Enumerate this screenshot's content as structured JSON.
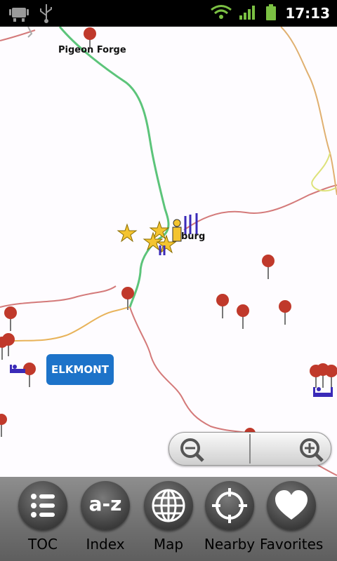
{
  "status_bar": {
    "time": "17:13",
    "icons": [
      "android-debug-icon",
      "usb-icon",
      "wifi-icon",
      "signal-icon",
      "battery-icon"
    ]
  },
  "map": {
    "places": {
      "pigeon_forge": "Pigeon Forge",
      "gatlinburg_partial": "burg"
    },
    "elkmont_button": "ELKMONT",
    "colors": {
      "road_green": "#5cc47a",
      "road_red": "#d06a6a",
      "road_orange": "#e8b35a",
      "road_yellow": "#dde27a",
      "pin": "#c0392b",
      "star": "#f4c430",
      "poi_blue": "#2a2ab0"
    }
  },
  "zoom": {
    "zoom_out_icon": "zoom-out-icon",
    "zoom_in_icon": "zoom-in-icon"
  },
  "toolbar": {
    "items": [
      {
        "label": "TOC",
        "icon": "list-icon"
      },
      {
        "label": "Index",
        "icon": "a-z-icon"
      },
      {
        "label": "Map",
        "icon": "globe-icon"
      },
      {
        "label": "Nearby",
        "icon": "crosshair-icon"
      },
      {
        "label": "Favorites",
        "icon": "heart-icon"
      }
    ],
    "index_glyph": "a-z"
  }
}
